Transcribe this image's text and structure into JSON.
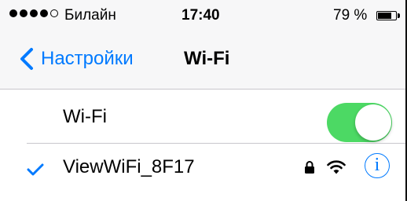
{
  "status_bar": {
    "carrier": "Билайн",
    "time": "17:40",
    "battery_percent": "79 %",
    "signal_bars": 4,
    "signal_total": 5
  },
  "nav": {
    "back_label": "Настройки",
    "title": "Wi-Fi"
  },
  "wifi_row": {
    "label": "Wi-Fi",
    "enabled": true
  },
  "network": {
    "name": "ViewWiFi_8F17",
    "connected": true,
    "secured": true,
    "info_glyph": "i"
  },
  "colors": {
    "accent": "#007aff",
    "toggle_on": "#4cd964"
  }
}
